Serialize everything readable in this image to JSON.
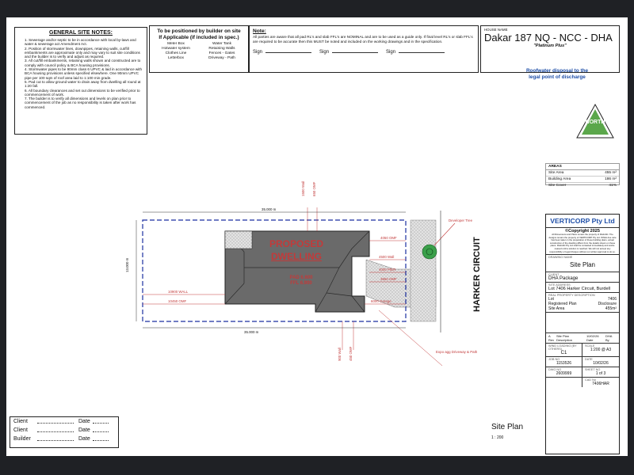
{
  "general_notes": {
    "title": "GENERAL SITE NOTES:",
    "items": [
      "1. Sewerage and/or septic to be in accordance with local by-laws and water & sewerage act Amendment Act.",
      "2. Position of stormwater lines, downpipes, retaining walls, cut/fill embankments are approximate only and may vary to suit site conditions and the builder is to verify and adjust as required.",
      "3. All cut/fill embankments, retaining walls shown and constructed are to comply with council policy & BCA housing provisions.",
      "4. Stormwater pipes to be 90mm class 6 UPVC & laid in accordance with BCA housing provisions unless specified elsewhere. One 90mm UPVC pipe per 100 sqm of roof area laid to 1:100 min grade.",
      "5. Pad cut to allow ground water to drain away from dwelling all round at 1:20 fall.",
      "6. All boundary clearances and set out dimensions to be verified prior to commencement of work.",
      "7. The builder is to verify all dimensions and levels on plan prior to commencement of the job as no responsibility is taken after work has commenced."
    ]
  },
  "builder_position": {
    "title_line1": "To be positioned by builder on site",
    "title_line2": "If Applicable (if included in spec.)",
    "items": [
      "Meter Box",
      "Water Tank",
      "Hotwater system",
      "Retaining Walls",
      "Clothes Line",
      "Fences - Gates",
      "Letterbox",
      "Driveway - Path"
    ]
  },
  "note_box": {
    "title": "Note:",
    "text": "All parties are aware that all pad RL's and slab FFL's are NOMINAL and are to be used as a guide only. If final level RL's or slab FFL's are required to be accurate then this MUST be noted and included on the working drawings and in the specification.",
    "sign_label": "Sign"
  },
  "house": {
    "label": "HOUSE NAME",
    "name": "Dakar 187 NQ - NCC - DHA",
    "sub": "\"Platinum Plus\""
  },
  "roofwater": {
    "line1": "Roofwater disposal to the",
    "line2": "legal point of discharge"
  },
  "north": {
    "label": "NORTH"
  },
  "areas": {
    "title": "AREAS",
    "rows": [
      {
        "label": "Site Area",
        "value": "455 m²"
      },
      {
        "label": "Building Area",
        "value": "186 m²"
      },
      {
        "label": "Site Cover",
        "value": "41%"
      }
    ]
  },
  "plan": {
    "top_dim": "35.000 m",
    "bottom_dim": "35.000 m",
    "left_dim": "13.000 m",
    "top_wall_1": "1500 Wall",
    "top_wall_2": "650 OMF",
    "bottom_wall_1": "900 Wall",
    "bottom_wall_2": "450 OMF",
    "right_4050": "4050 OMF",
    "right_4500": "4500 Wall",
    "right_4000": "4000 PIER",
    "right_3550": "3550 OMF",
    "garage": "6000 Garage",
    "left_wall": "10900 WALL",
    "left_omf": "10450 OMF",
    "proposed_1": "PROPOSED",
    "proposed_2": "DWELLING",
    "pad": "PAD 6.600",
    "ffl": "FFL 6.900",
    "developer_tree": "Developer Tree",
    "street": "HARKER CIRCUIT",
    "driveway": "Expo agg Driveway & Path"
  },
  "title_block": {
    "company": "VERTICORP Pty Ltd",
    "copyright": "©Copyright 2025",
    "legal": "All Dimensions and Plans remain the property of RisiCAD. The designs remain the property of VERTICORP Pty Ltd. Whilst due care has been taken in the preparation of these building plans, actual construction of the dwelling differs from the details shown on these plans. RisiCAD Pty Ltd shall be contacted immediately and works ceased until a solution is reached. We will not accept any responsibility or legal charges without our written approval to do so.",
    "drawing_label": "DRAWING NAME",
    "drawing_name": "Site Plan",
    "client_label": "CLIENT",
    "client_name": "DHA Package",
    "site_label": "SITE ADDRESS",
    "site_address": "Lot 7406 Harker Circuit, Burdell",
    "real_label": "REAL PROPERTY DESCRIPTION",
    "lot_label": "Lot",
    "lot_value": "7406",
    "reg_label": "Registered Plan",
    "reg_value": "Disclosure",
    "site_area_label": "Site Area",
    "site_area_value": "455m²",
    "rev_letter": "A",
    "rev_desc": "Site Plan",
    "rev_date": "10/02/26",
    "rev_check": "DHA",
    "rev_h1": "Rev",
    "rev_h2": "Description",
    "rev_h3": "Date",
    "rev_h4": "By",
    "wind_label": "WIND LOADING (BY OTHERS)",
    "wind_value": "C1",
    "scale_label": "SCALE",
    "scale_value": "1:200 @ A3",
    "job_label": "JOB NO",
    "job_value": "1153526",
    "date_label": "DATE",
    "date_value": "10/02/26",
    "dwg_label": "DWG NO",
    "dwg_value": "2609999",
    "sheet_label": "SHEET NO",
    "sheet_value": "1 of 3",
    "cad_label": "CAD No",
    "cad_value": "7406HAR"
  },
  "bottom": {
    "title": "Site Plan",
    "scale": "1 : 200"
  },
  "client_box": {
    "rows": [
      {
        "label": "Client",
        "date": "Date"
      },
      {
        "label": "Client",
        "date": "Date"
      },
      {
        "label": "Builder",
        "date": "Date"
      }
    ]
  }
}
